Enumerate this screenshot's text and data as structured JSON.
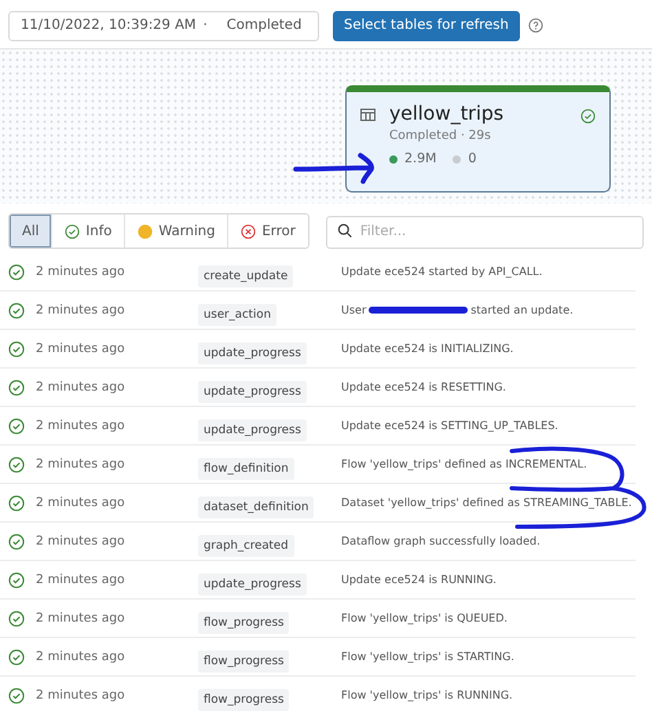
{
  "toolbar": {
    "update_select": {
      "timestamp": "11/10/2022, 10:39:29 AM",
      "separator": "·",
      "status": "Completed"
    },
    "refresh_button": "Select tables for refresh"
  },
  "graph": {
    "node": {
      "name": "yellow_trips",
      "status": "Completed · 29s",
      "metrics": [
        {
          "value": "2.9M",
          "color": "#3a9a5b"
        },
        {
          "value": "0",
          "color": "#c8ccd0"
        }
      ]
    }
  },
  "filters": [
    {
      "label": "All",
      "kind": "plain",
      "selected": true
    },
    {
      "label": "Info",
      "kind": "info",
      "selected": false
    },
    {
      "label": "Warning",
      "kind": "warning",
      "selected": false
    },
    {
      "label": "Error",
      "kind": "error",
      "selected": false
    }
  ],
  "search": {
    "placeholder": "Filter..."
  },
  "events": [
    {
      "time": "2 minutes ago",
      "type": "create_update",
      "message": "Update ece524 started by API_CALL."
    },
    {
      "time": "2 minutes ago",
      "type": "user_action",
      "message": "User",
      "redacted": true,
      "message_tail": "started an update."
    },
    {
      "time": "2 minutes ago",
      "type": "update_progress",
      "message": "Update ece524 is INITIALIZING."
    },
    {
      "time": "2 minutes ago",
      "type": "update_progress",
      "message": "Update ece524 is RESETTING."
    },
    {
      "time": "2 minutes ago",
      "type": "update_progress",
      "message": "Update ece524 is SETTING_UP_TABLES."
    },
    {
      "time": "2 minutes ago",
      "type": "flow_definition",
      "message": "Flow 'yellow_trips' defined as INCREMENTAL."
    },
    {
      "time": "2 minutes ago",
      "type": "dataset_definition",
      "message": "Dataset 'yellow_trips' defined as STREAMING_TABLE."
    },
    {
      "time": "2 minutes ago",
      "type": "graph_created",
      "message": "Dataflow graph successfully loaded."
    },
    {
      "time": "2 minutes ago",
      "type": "update_progress",
      "message": "Update ece524 is RUNNING."
    },
    {
      "time": "2 minutes ago",
      "type": "flow_progress",
      "message": "Flow 'yellow_trips' is QUEUED."
    },
    {
      "time": "2 minutes ago",
      "type": "flow_progress",
      "message": "Flow 'yellow_trips' is STARTING."
    },
    {
      "time": "2 minutes ago",
      "type": "flow_progress",
      "message": "Flow 'yellow_trips' is RUNNING."
    }
  ]
}
